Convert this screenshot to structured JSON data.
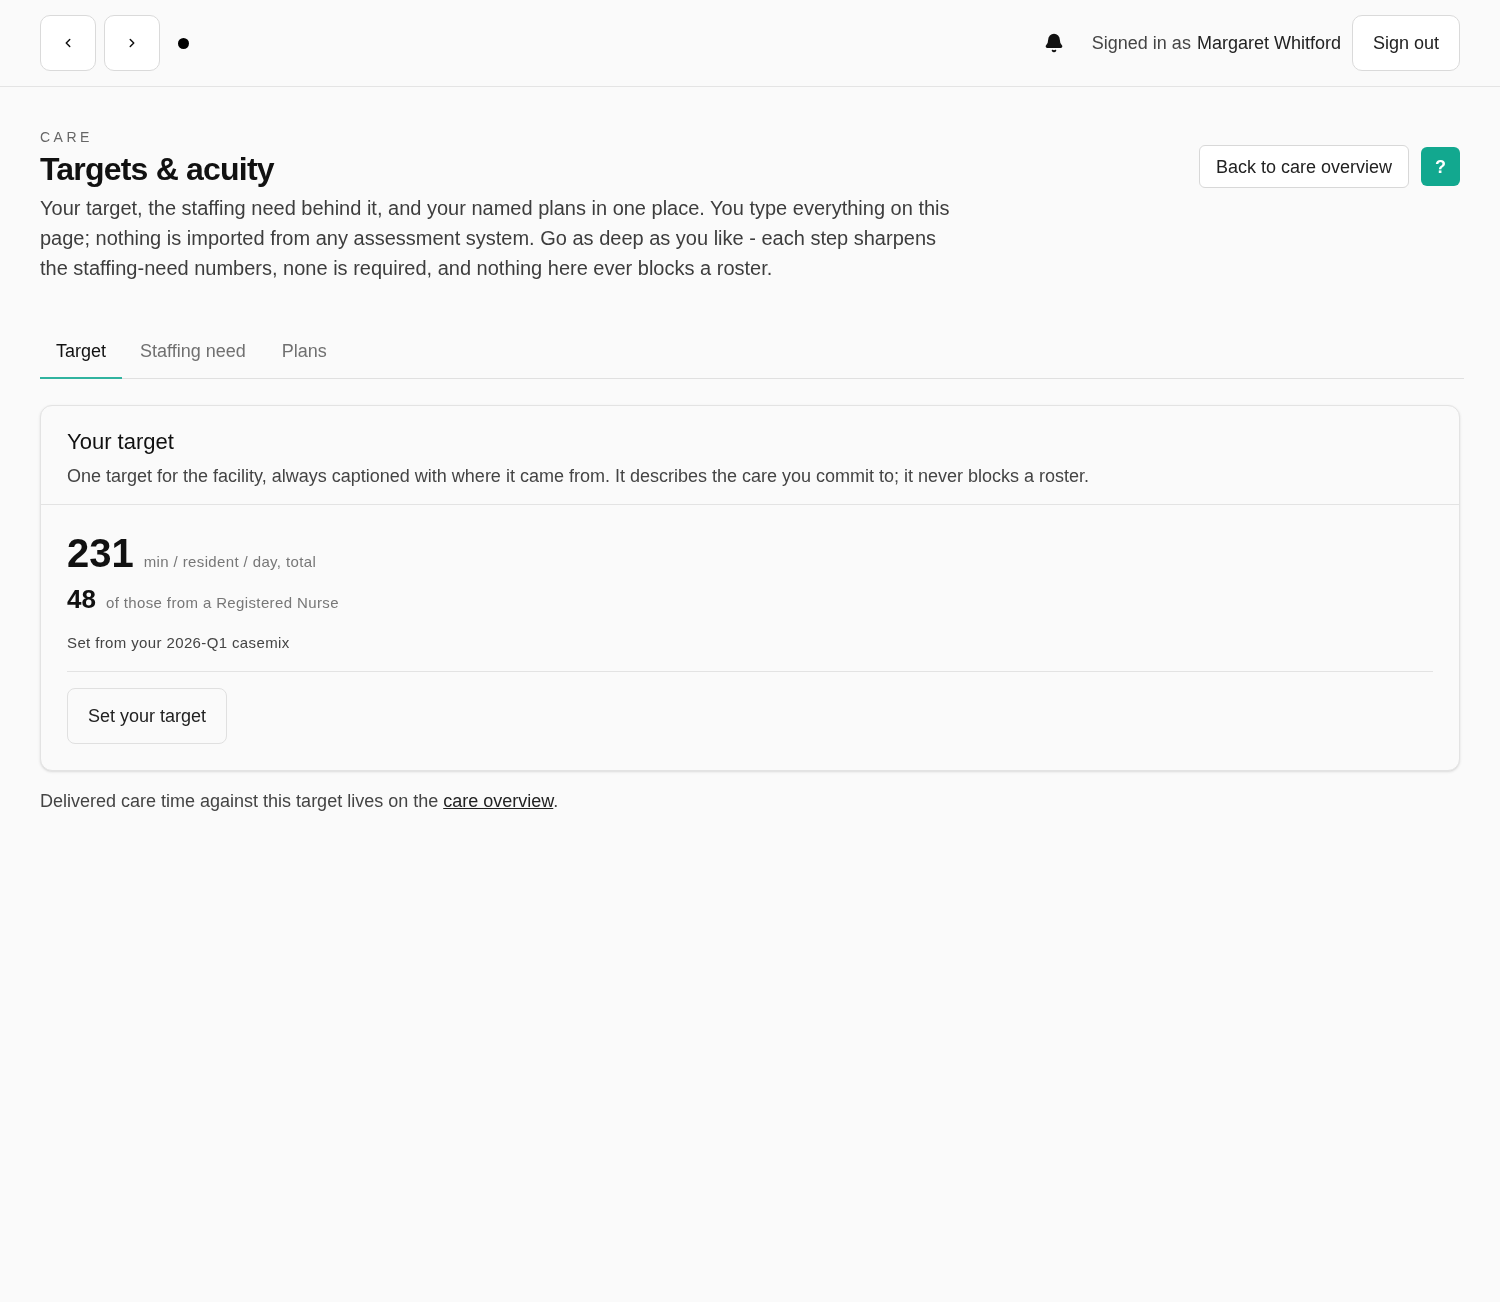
{
  "header": {
    "signed_in_prefix": "Signed in as",
    "user_name": "Margaret Whitford",
    "sign_out_button": "Sign out"
  },
  "page": {
    "eyebrow": "CARE",
    "title": "Targets & acuity",
    "intro": "Your target, the staffing need behind it, and your named plans in one place. You type everything on this page; nothing is imported from any assessment system. Go as deep as you like - each step sharpens the staffing-need numbers, none is required, and nothing here ever blocks a roster.",
    "back_button": "Back to care overview",
    "help_button": "?"
  },
  "tabs": [
    {
      "label": "Target",
      "selected": true
    },
    {
      "label": "Staffing need",
      "selected": false
    },
    {
      "label": "Plans",
      "selected": false
    }
  ],
  "target_card": {
    "title": "Your target",
    "description": "One target for the facility, always captioned with where it came from. It describes the care you commit to; it never blocks a roster.",
    "total_value": "231",
    "total_unit": "min / resident / day, total",
    "rn_value": "48",
    "rn_unit": "of those from a Registered Nurse",
    "source": "Set from your 2026-Q1 casemix",
    "action_button": "Set your target"
  },
  "footer_note": {
    "text": "Delivered care time against this target lives on the",
    "link": "care overview",
    "after": "."
  }
}
